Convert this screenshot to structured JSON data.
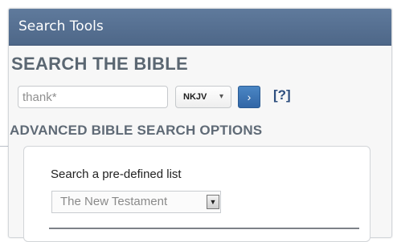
{
  "panel": {
    "header_title": "Search Tools"
  },
  "search": {
    "title": "SEARCH THE BIBLE",
    "query_value": "thank*",
    "version_selected": "NKJV",
    "go_icon": "chevron-right-icon",
    "go_glyph": "›",
    "help_label": "[?]"
  },
  "advanced": {
    "title": "ADVANCED BIBLE SEARCH OPTIONS",
    "predefined_label": "Search a pre-defined list",
    "predefined_selected": "The New Testament"
  },
  "colors": {
    "header_bg": "#55718f",
    "go_button": "#3a74b6",
    "help_link": "#2d4e7e",
    "section_text": "#5f6a76"
  }
}
